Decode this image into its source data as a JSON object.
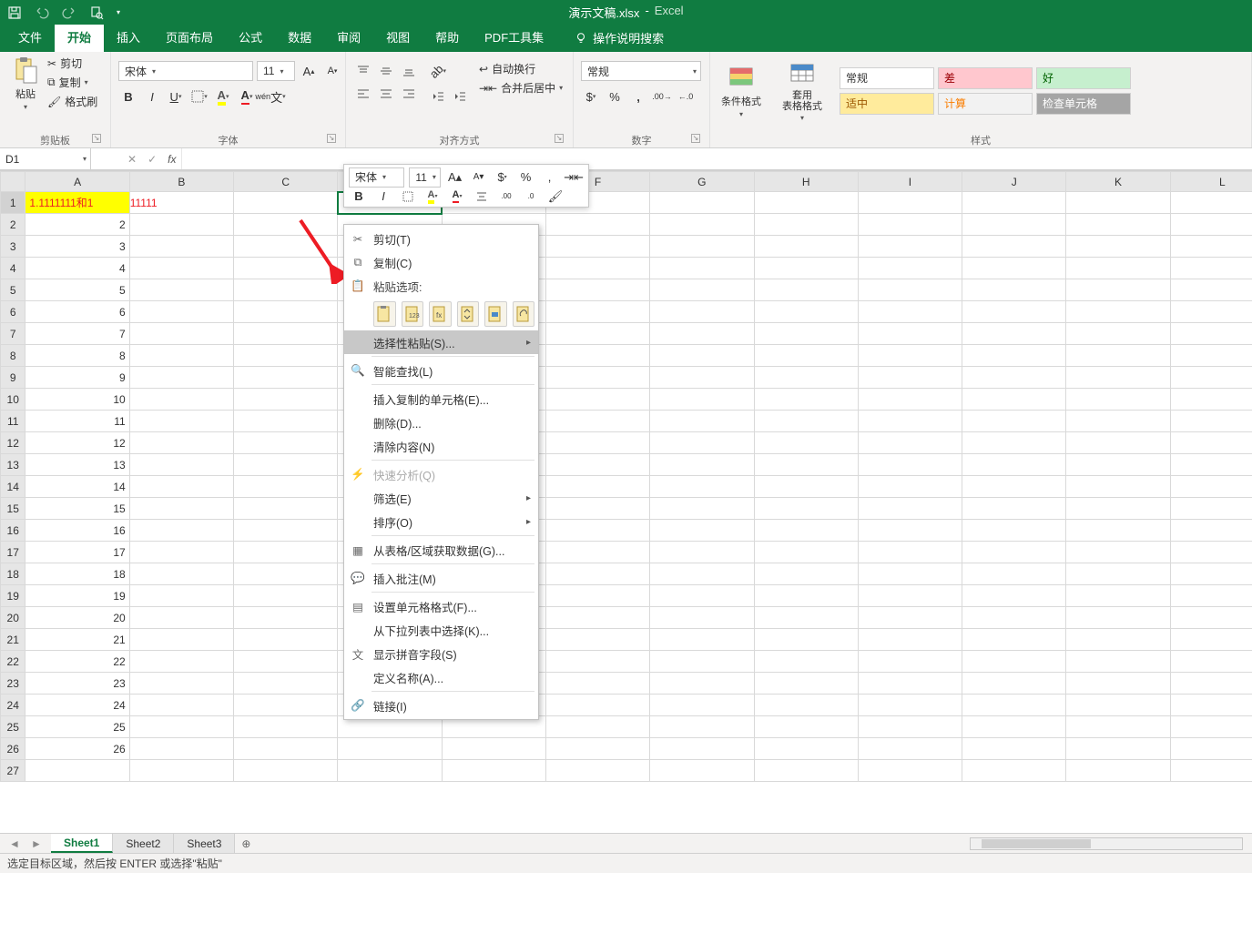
{
  "title": {
    "doc": "演示文稿.xlsx",
    "sep": "-",
    "app": "Excel"
  },
  "tabs": {
    "file": "文件",
    "home": "开始",
    "insert": "插入",
    "layout": "页面布局",
    "formulas": "公式",
    "data": "数据",
    "review": "审阅",
    "view": "视图",
    "help": "帮助",
    "pdf": "PDF工具集",
    "tellme": "操作说明搜索"
  },
  "ribbon": {
    "clipboard": {
      "paste": "粘贴",
      "cut": "剪切",
      "copy": "复制",
      "painter": "格式刷",
      "label": "剪贴板"
    },
    "font": {
      "name": "宋体",
      "size": "11",
      "label": "字体"
    },
    "align": {
      "wrap": "自动换行",
      "merge": "合并后居中",
      "label": "对齐方式"
    },
    "number": {
      "format": "常规",
      "label": "数字"
    },
    "styles": {
      "cond": "条件格式",
      "table": "套用\n表格格式",
      "normal": "常规",
      "bad": "差",
      "good": "好",
      "neutral": "适中",
      "calc": "计算",
      "check": "检查单元格",
      "label": "样式"
    }
  },
  "fbar": {
    "name": "D1",
    "fx": "fx"
  },
  "columns": [
    "A",
    "B",
    "C",
    "D",
    "E",
    "F",
    "G",
    "H",
    "I",
    "J",
    "K",
    "L"
  ],
  "row_count": 27,
  "cells": {
    "A1": "1.1111111和1",
    "B1_overflow": "11111",
    "A": [
      "",
      "2",
      "3",
      "4",
      "5",
      "6",
      "7",
      "8",
      "9",
      "10",
      "11",
      "12",
      "13",
      "14",
      "15",
      "16",
      "17",
      "18",
      "19",
      "20",
      "21",
      "22",
      "23",
      "24",
      "25",
      "26",
      ""
    ]
  },
  "mini": {
    "font": "宋体",
    "size": "11"
  },
  "ctx": {
    "cut": "剪切(T)",
    "copy": "复制(C)",
    "pasteopt": "粘贴选项:",
    "pastespecial": "选择性粘贴(S)...",
    "smartlookup": "智能查找(L)",
    "insert": "插入复制的单元格(E)...",
    "delete": "删除(D)...",
    "clear": "清除内容(N)",
    "quick": "快速分析(Q)",
    "filter": "筛选(E)",
    "sort": "排序(O)",
    "gettable": "从表格/区域获取数据(G)...",
    "comment": "插入批注(M)",
    "format": "设置单元格格式(F)...",
    "picklist": "从下拉列表中选择(K)...",
    "pinyin": "显示拼音字段(S)",
    "define": "定义名称(A)...",
    "link": "链接(I)"
  },
  "sheets": {
    "s1": "Sheet1",
    "s2": "Sheet2",
    "s3": "Sheet3"
  },
  "status": "选定目标区域，然后按 ENTER 或选择\"粘贴\""
}
